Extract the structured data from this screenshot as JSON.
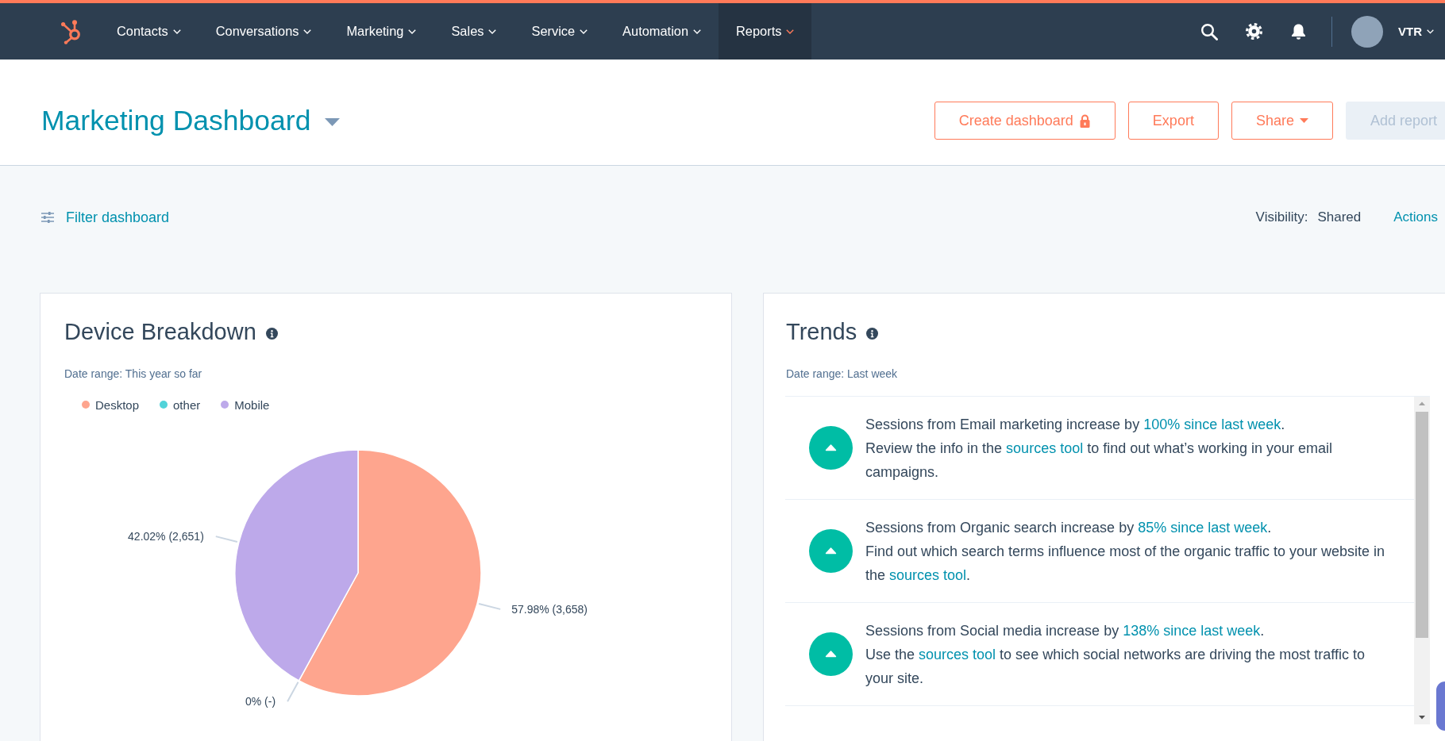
{
  "nav": {
    "items": [
      {
        "label": "Contacts",
        "selected": false
      },
      {
        "label": "Conversations",
        "selected": false
      },
      {
        "label": "Marketing",
        "selected": false
      },
      {
        "label": "Sales",
        "selected": false
      },
      {
        "label": "Service",
        "selected": false
      },
      {
        "label": "Automation",
        "selected": false
      },
      {
        "label": "Reports",
        "selected": true
      }
    ],
    "user": "VTR"
  },
  "header": {
    "title": "Marketing Dashboard",
    "buttons": [
      {
        "label": "Create dashboard",
        "kind": "locked",
        "disabled": false
      },
      {
        "label": "Export",
        "kind": "plain",
        "disabled": false
      },
      {
        "label": "Share",
        "kind": "dropdown",
        "disabled": false
      },
      {
        "label": "Add report",
        "kind": "plain",
        "disabled": true
      }
    ]
  },
  "filter_bar": {
    "filter": "Filter dashboard",
    "visibility_label": "Visibility:",
    "visibility": "Shared",
    "actions": "Actions"
  },
  "device_breakdown": {
    "title": "Device Breakdown",
    "date_range": "Date range: This year so far",
    "legend": [
      {
        "color": "#fea58e"
      },
      {
        "color": "#51d3d9"
      },
      {
        "color": "#bda9ea"
      }
    ],
    "chart_data": {
      "type": "pie",
      "categories": [
        "Desktop",
        "other",
        "Mobile"
      ],
      "values": [
        3658,
        0,
        2651
      ],
      "value_labels": [
        "57.98% (3,658)",
        "0% (-)",
        "42.02% (2,651)"
      ]
    }
  },
  "trends": {
    "title": "Trends",
    "date_range": "Date range: Last week",
    "items": [
      {
        "increasing": true,
        "summary": [
          {
            "kind": "text",
            "text": "Sessions from Email marketing increase by "
          },
          {
            "kind": "link",
            "text": "100% since last week"
          },
          {
            "kind": "text",
            "text": "."
          }
        ],
        "detail": [
          {
            "kind": "text",
            "text": "Review the info in the "
          },
          {
            "kind": "link",
            "text": "sources tool"
          },
          {
            "kind": "text",
            "text": " to find out what’s working in your email campaigns."
          }
        ]
      },
      {
        "increasing": true,
        "summary": [
          {
            "kind": "text",
            "text": "Sessions from Organic search increase by "
          },
          {
            "kind": "link",
            "text": "85% since last week"
          },
          {
            "kind": "text",
            "text": "."
          }
        ],
        "detail": [
          {
            "kind": "text",
            "text": "Find out which search terms influence most of the organic traffic to your website in the "
          },
          {
            "kind": "link",
            "text": "sources tool"
          },
          {
            "kind": "text",
            "text": "."
          }
        ]
      },
      {
        "increasing": true,
        "summary": [
          {
            "kind": "text",
            "text": "Sessions from Social media increase by "
          },
          {
            "kind": "link",
            "text": "138% since last week"
          },
          {
            "kind": "text",
            "text": "."
          }
        ],
        "detail": [
          {
            "kind": "text",
            "text": "Use the "
          },
          {
            "kind": "link",
            "text": "sources tool"
          },
          {
            "kind": "text",
            "text": " to see which social networks are driving the most traffic to your site."
          }
        ]
      }
    ]
  }
}
